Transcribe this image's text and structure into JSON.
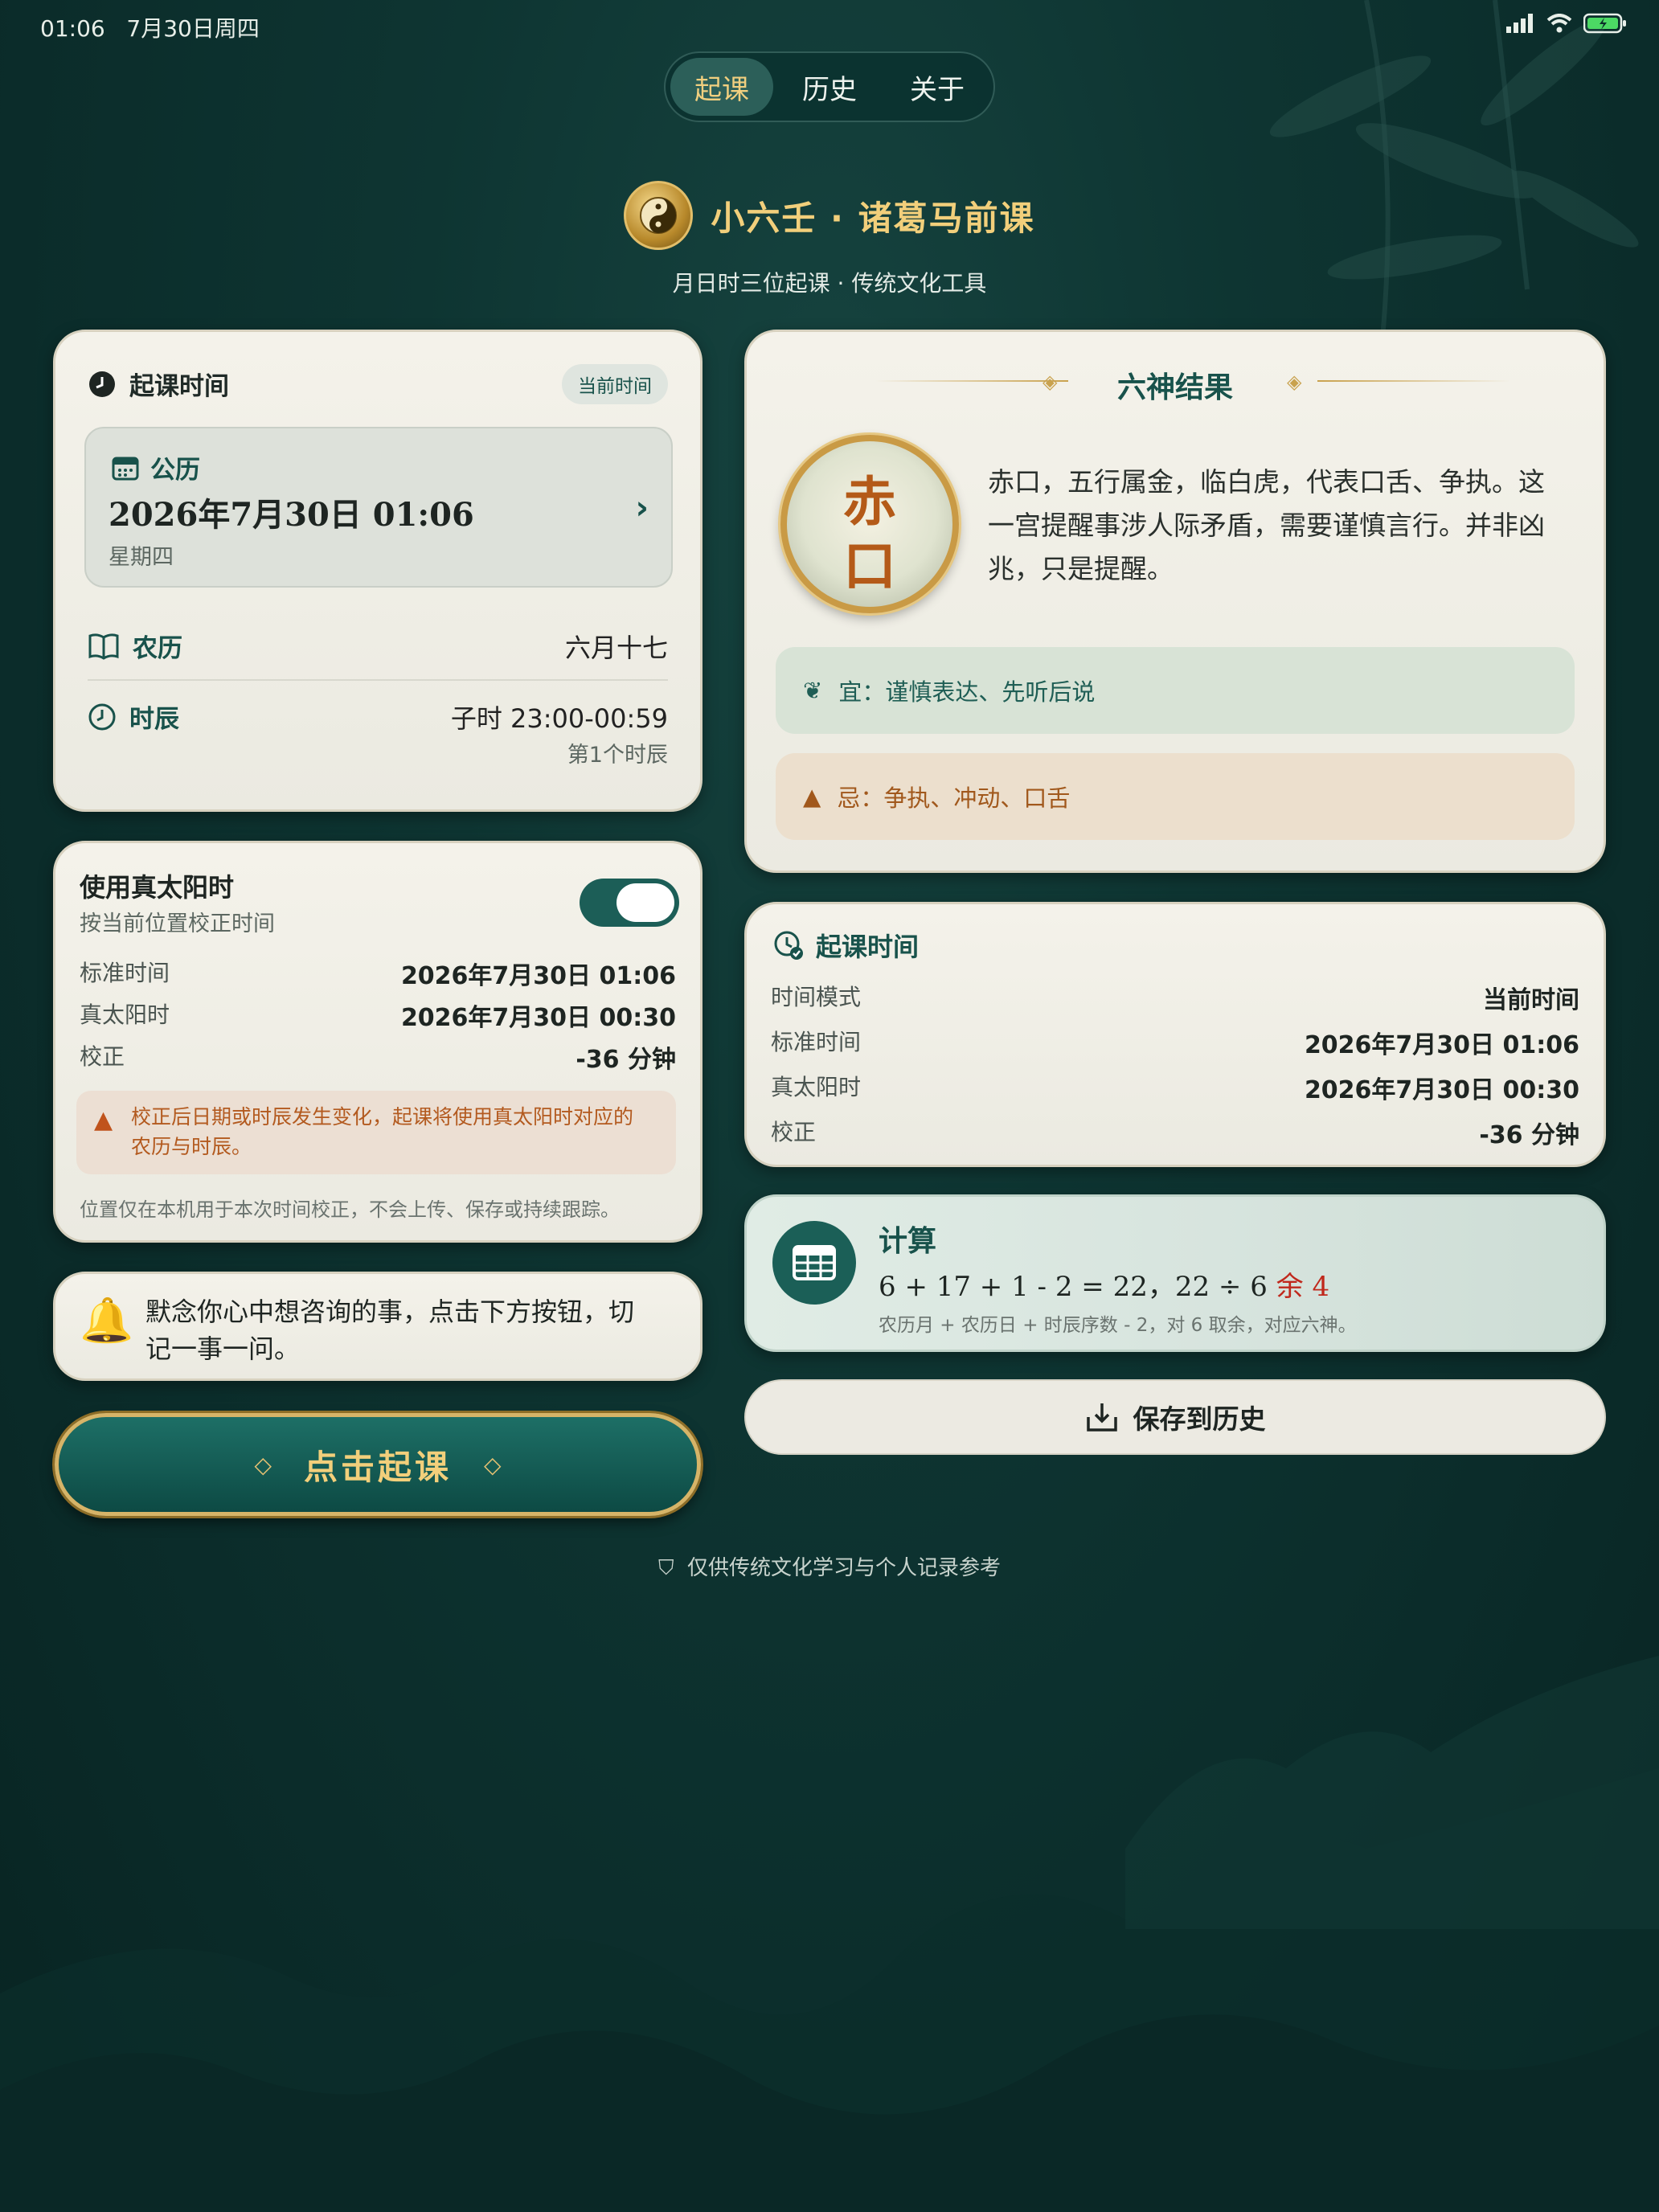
{
  "status_bar": {
    "time": "01:06",
    "date": "7月30日周四"
  },
  "tabs": [
    {
      "label": "起课",
      "active": true
    },
    {
      "label": "历史",
      "active": false
    },
    {
      "label": "关于",
      "active": false
    }
  ],
  "header": {
    "title": "小六壬 · 诸葛马前课",
    "subtitle": "月日时三位起课 · 传统文化工具"
  },
  "time_card": {
    "title": "起课时间",
    "mode_pill": "当前时间",
    "solar": {
      "label": "公历",
      "date": "2026年7月30日 01:06",
      "weekday": "星期四"
    },
    "lunar": {
      "label": "农历",
      "value": "六月十七"
    },
    "shichen": {
      "label": "时辰",
      "value": "子时 23:00-00:59",
      "sub": "第1个时辰"
    }
  },
  "solar_time_card": {
    "title": "使用真太阳时",
    "subtitle": "按当前位置校正时间",
    "enabled": true,
    "rows": [
      {
        "label": "标准时间",
        "value": "2026年7月30日 01:06"
      },
      {
        "label": "真太阳时",
        "value": "2026年7月30日 00:30"
      },
      {
        "label": "校正",
        "value": "-36 分钟"
      }
    ],
    "warning": "校正后日期或时辰发生变化，起课将使用真太阳时对应的农历与时辰。",
    "footnote": "位置仅在本机用于本次时间校正，不会上传、保存或持续跟踪。"
  },
  "hint_card": {
    "text": "默念你心中想咨询的事，点击下方按钮，切记一事一问。"
  },
  "start_button": {
    "label": "点击起课"
  },
  "disclaimer": "仅供传统文化学习与个人记录参考",
  "result_card": {
    "title": "六神结果",
    "name_char_1": "赤",
    "name_char_2": "口",
    "description": "赤口，五行属金，临白虎，代表口舌、争执。这一宫提醒事涉人际矛盾，需要谨慎言行。并非凶兆，只是提醒。",
    "good": "宜：谨慎表达、先听后说",
    "bad": "忌：争执、冲动、口舌"
  },
  "result_time_card": {
    "title": "起课时间",
    "rows": [
      {
        "label": "时间模式",
        "value": "当前时间"
      },
      {
        "label": "标准时间",
        "value": "2026年7月30日 01:06"
      },
      {
        "label": "真太阳时",
        "value": "2026年7月30日 00:30"
      },
      {
        "label": "校正",
        "value": "-36 分钟"
      }
    ]
  },
  "calc_card": {
    "title": "计算",
    "expression": "6 + 17 + 1 - 2 = 22，22 ÷ 6 ",
    "remainder_label": "余 4",
    "note": "农历月 + 农历日 + 时辰序数 - 2，对 6 取余，对应六神。"
  },
  "save_button": {
    "label": "保存到历史"
  },
  "colors": {
    "accent": "#18524b",
    "gold": "#f2cf7b",
    "warning": "#b35a1f",
    "remainder": "#c0281c"
  }
}
